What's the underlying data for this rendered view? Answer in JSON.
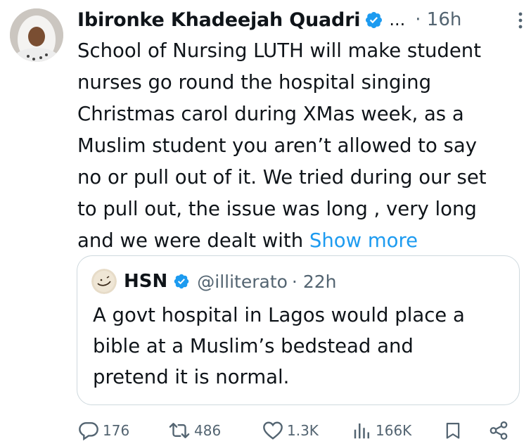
{
  "tweet": {
    "author": {
      "name": "Ibironke Khadeejah Quadri",
      "verified": true
    },
    "ellipsis": "...",
    "time": "· 16h",
    "lines": [
      "School of Nursing LUTH will make student",
      "nurses go round the hospital singing",
      "Christmas carol during XMas week, as a",
      "Muslim student you aren’t allowed to say",
      "no or pull out of it. We tried during our set",
      "to pull out, the issue was long , very long"
    ],
    "last_line": "and we were dealt with ",
    "show_more": "Show more"
  },
  "quote": {
    "name": "HSN",
    "handle": "@illiterato",
    "time": "· 22h",
    "lines": [
      "A govt hospital in Lagos would place a",
      "bible at a Muslim’s  bedstead and",
      "pretend it is normal."
    ]
  },
  "actions": {
    "replies": "176",
    "reposts": "486",
    "likes": "1.3K",
    "views": "166K"
  },
  "colors": {
    "link": "#1d9bf0",
    "verified": "#1d9bf0",
    "muted": "#536471",
    "text": "#0f1419",
    "border": "#cfd9de"
  }
}
